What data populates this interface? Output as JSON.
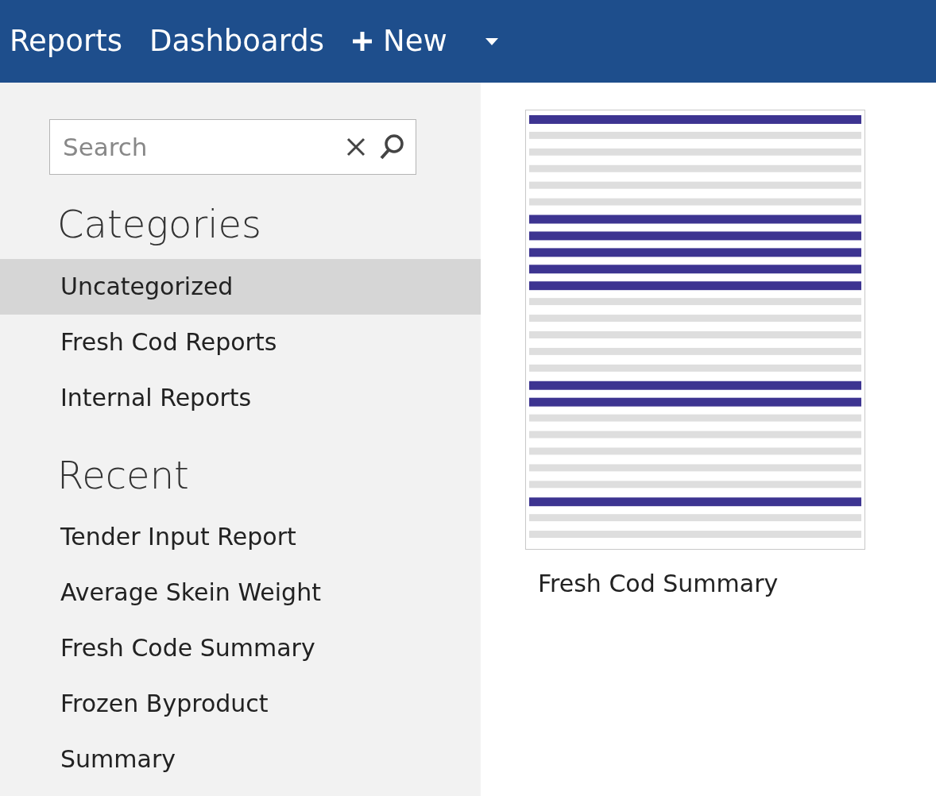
{
  "nav": {
    "items": [
      {
        "label": "Reports"
      },
      {
        "label": "Dashboards"
      }
    ],
    "new_button": {
      "label": "New"
    }
  },
  "sidebar": {
    "search": {
      "placeholder": "Search"
    },
    "categories": {
      "title": "Categories",
      "items": [
        {
          "label": "Uncategorized",
          "selected": true
        },
        {
          "label": "Fresh Cod Reports",
          "selected": false
        },
        {
          "label": "Internal Reports",
          "selected": false
        }
      ]
    },
    "recent": {
      "title": "Recent",
      "items": [
        {
          "label": "Tender Input Report"
        },
        {
          "label": "Average Skein Weight"
        },
        {
          "label": "Fresh Code Summary"
        },
        {
          "label": "Frozen Byproduct"
        },
        {
          "label": "Summary"
        }
      ]
    }
  },
  "reports": [
    {
      "title": "Fresh Cod Summary"
    }
  ]
}
